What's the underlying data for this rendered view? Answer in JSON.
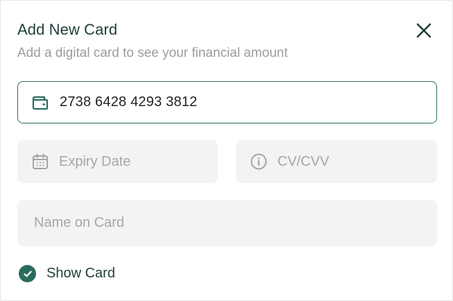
{
  "dialog": {
    "title": "Add New Card",
    "subtitle": "Add a digital card to see your financial amount",
    "close_icon": "close-icon"
  },
  "form": {
    "card_number": {
      "icon": "wallet-icon",
      "value": "2738 6428 4293 3812",
      "placeholder": ""
    },
    "expiry": {
      "icon": "calendar-icon",
      "value": "",
      "placeholder": "Expiry Date"
    },
    "cvv": {
      "icon": "info-icon",
      "value": "",
      "placeholder": "CV/CVV"
    },
    "name": {
      "value": "",
      "placeholder": "Name on Card"
    },
    "show_card": {
      "label": "Show Card",
      "checked": true
    }
  },
  "colors": {
    "accent": "#2a6b60",
    "title": "#1f3d3a",
    "muted_text": "#9c9c9c",
    "field_bg": "#f3f3f3"
  }
}
